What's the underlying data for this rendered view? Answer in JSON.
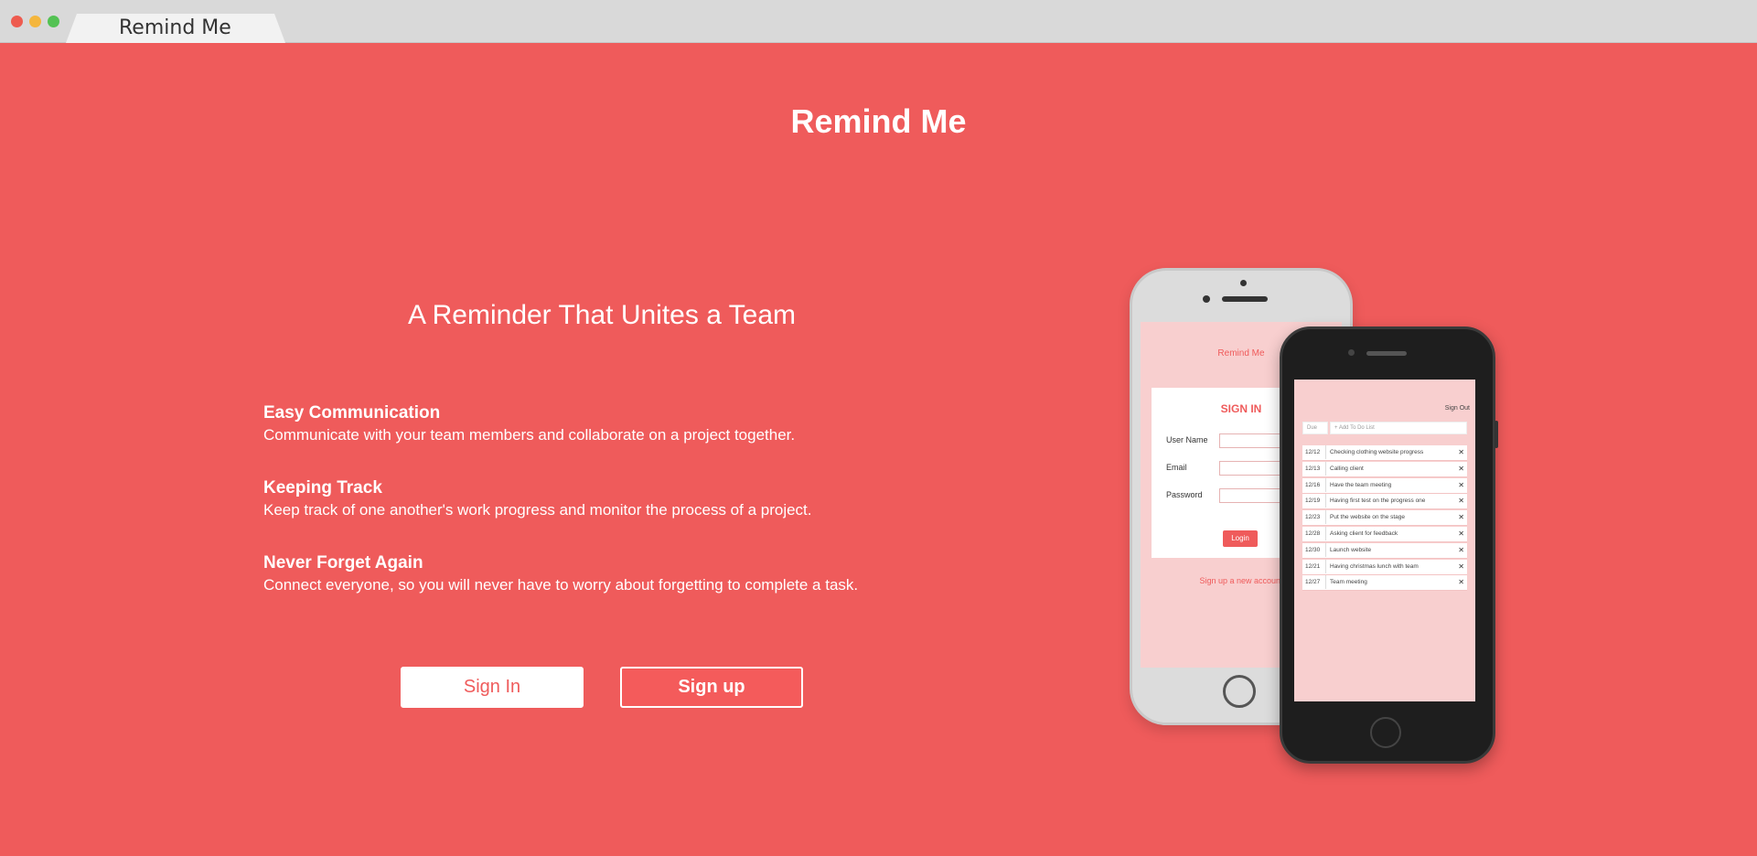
{
  "browser": {
    "tab_title": "Remind Me"
  },
  "page": {
    "app_title": "Remind Me",
    "headline": "A Reminder That Unites a Team",
    "features": [
      {
        "title": "Easy Communication",
        "desc": "Communicate with your team members and collaborate on a project together."
      },
      {
        "title": "Keeping Track",
        "desc": "Keep track of one another's work progress and monitor the process of a project."
      },
      {
        "title": "Never Forget Again",
        "desc": "Connect everyone, so you will never have to worry about forgetting to complete a task."
      }
    ],
    "buttons": {
      "sign_in": "Sign In",
      "sign_up": "Sign up"
    }
  },
  "mockup_signin": {
    "brand": "Remind Me",
    "title": "SIGN IN",
    "labels": [
      "User Name",
      "Email",
      "Password"
    ],
    "login_button": "Login",
    "signup_link": "Sign up a new account"
  },
  "mockup_todo": {
    "sign_out": "Sign Out",
    "due_placeholder": "Due",
    "add_placeholder": "+ Add To Do List",
    "items": [
      {
        "date": "12/12",
        "text": "Checking clothing website progress"
      },
      {
        "date": "12/13",
        "text": "Calling client"
      },
      {
        "date": "12/16",
        "text": "Have the team meeting"
      },
      {
        "date": "12/19",
        "text": "Having first test on the progress one"
      },
      {
        "date": "12/23",
        "text": "Put the website on the stage"
      },
      {
        "date": "12/28",
        "text": "Asking client for feedback"
      },
      {
        "date": "12/30",
        "text": "Launch website"
      },
      {
        "date": "12/21",
        "text": "Having christmas lunch with team"
      },
      {
        "date": "12/27",
        "text": "Team meeting"
      }
    ],
    "delete_glyph": "✕"
  },
  "colors": {
    "background": "#ef5b5b",
    "accent": "#ef5b5b",
    "text": "#ffffff"
  }
}
